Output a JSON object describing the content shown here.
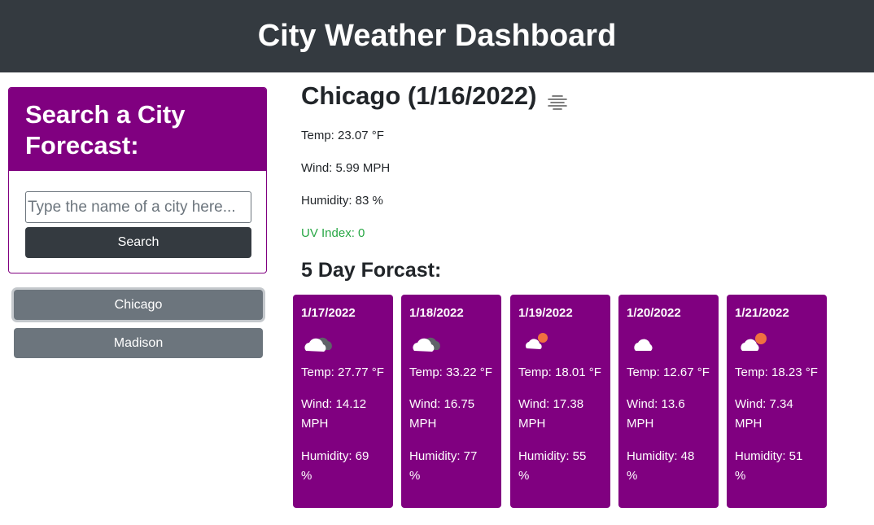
{
  "header": {
    "title": "City Weather Dashboard"
  },
  "search": {
    "heading": "Search a City Forecast:",
    "placeholder": "Type the name of a city here...",
    "button_label": "Search"
  },
  "history": [
    {
      "label": "Chicago"
    },
    {
      "label": "Madison"
    }
  ],
  "current": {
    "title": "Chicago (1/16/2022)",
    "icon": "fog-icon",
    "temp": "Temp: 23.07 °F",
    "wind": "Wind: 5.99 MPH",
    "humidity": "Humidity: 83 %",
    "uv": "UV Index: 0"
  },
  "forecast": {
    "title": "5 Day Forcast:",
    "days": [
      {
        "date": "1/17/2022",
        "icon": "cloudy-icon",
        "temp": "Temp: 27.77 °F",
        "wind_a": "Wind: 14.12",
        "wind_b": "MPH",
        "hum_a": "Humidity: 69",
        "hum_b": "%"
      },
      {
        "date": "1/18/2022",
        "icon": "cloudy-icon",
        "temp": "Temp: 33.22 °F",
        "wind_a": "Wind: 16.75",
        "wind_b": "MPH",
        "hum_a": "Humidity: 77",
        "hum_b": "%"
      },
      {
        "date": "1/19/2022",
        "icon": "partly-cloudy-icon",
        "temp": "Temp: 18.01 °F",
        "wind_a": "Wind: 17.38",
        "wind_b": "MPH",
        "hum_a": "Humidity: 55",
        "hum_b": "%"
      },
      {
        "date": "1/20/2022",
        "icon": "cloud-icon",
        "temp": "Temp: 12.67 °F",
        "wind_a": "Wind: 13.6",
        "wind_b": "MPH",
        "hum_a": "Humidity: 48",
        "hum_b": "%"
      },
      {
        "date": "1/21/2022",
        "icon": "partly-cloudy-icon",
        "temp": "Temp: 18.23 °F",
        "wind_a": "Wind: 7.34",
        "wind_b": "MPH",
        "hum_a": "Humidity: 51",
        "hum_b": "%"
      }
    ]
  },
  "colors": {
    "header_bg": "#343a40",
    "accent_purple": "#800080",
    "history_button": "#6c757d",
    "uv_green": "#28a745"
  }
}
